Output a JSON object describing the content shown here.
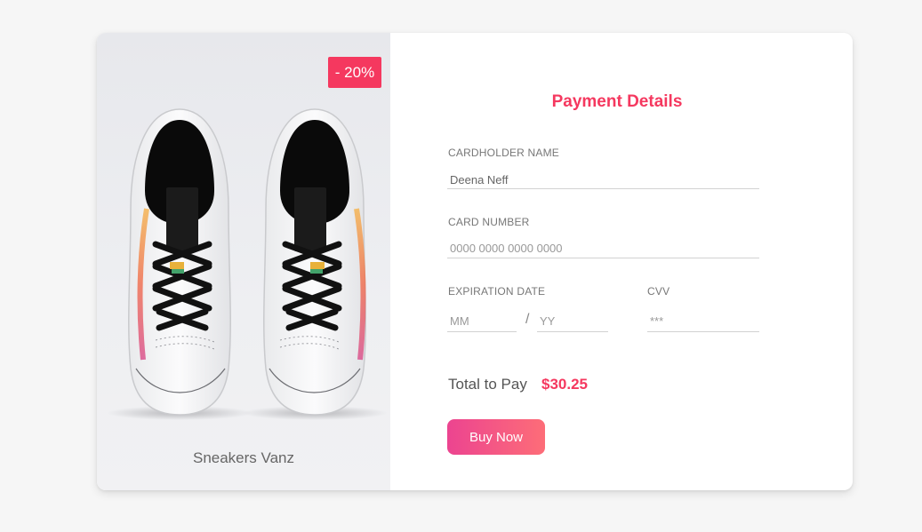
{
  "product": {
    "discount_badge": "- 20%",
    "name": "Sneakers Vanz",
    "image_icon": "sneakers-image"
  },
  "form": {
    "title": "Payment Details",
    "cardholder_label": "CARDHOLDER NAME",
    "cardholder_value": "Deena Neff",
    "card_number_label": "CARD NUMBER",
    "card_number_placeholder": "0000 0000 0000 0000",
    "expiration_label": "EXPIRATION DATE",
    "month_placeholder": "MM",
    "separator": "/",
    "year_placeholder": "YY",
    "cvv_label": "CVV",
    "cvv_placeholder": "***",
    "total_label": "Total to Pay",
    "total_value": "$30.25",
    "buy_label": "Buy Now"
  },
  "colors": {
    "accent": "#f5385f",
    "button_gradient_start": "#ec4490",
    "button_gradient_end": "#fd6d78",
    "page_background": "#f6f6f6"
  }
}
